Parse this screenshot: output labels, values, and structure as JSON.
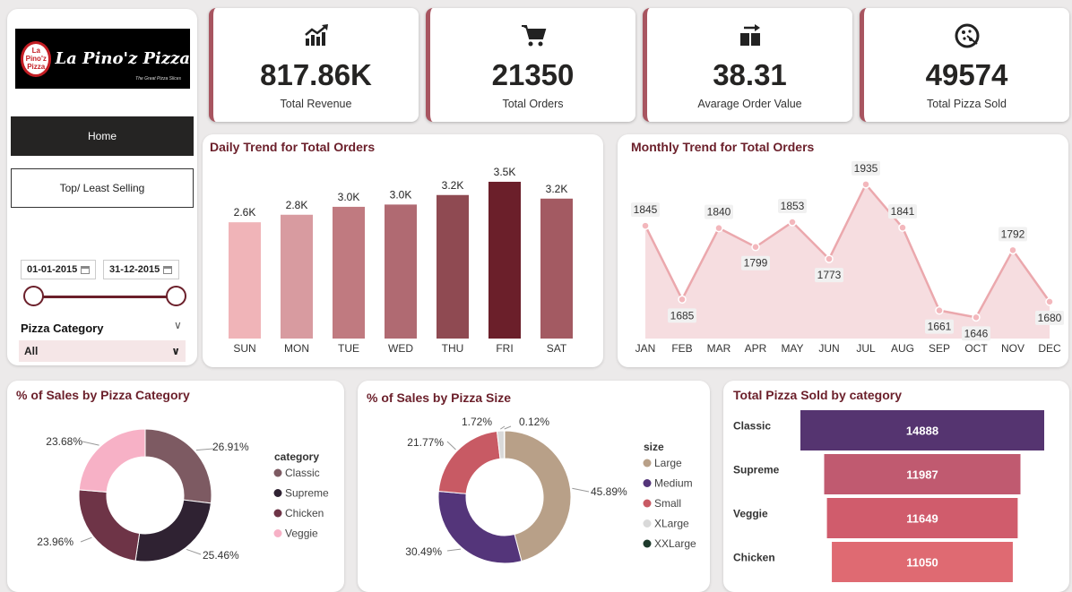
{
  "sidebar": {
    "logo_text": "La Pino'z Pizza",
    "logo_badge_line1": "La Pino'z",
    "logo_badge_line2": "Pizza",
    "logo_tagline": "The Great Pizza Slices",
    "nav": {
      "home": "Home",
      "top_least": "Top/ Least Selling"
    },
    "date_start": "01-01-2015",
    "date_end": "31-12-2015",
    "category_label": "Pizza Category",
    "category_value": "All"
  },
  "kpis": [
    {
      "icon": "trending-up-chart-icon",
      "value": "817.86K",
      "label": "Total Revenue"
    },
    {
      "icon": "shopping-cart-icon",
      "value": "21350",
      "label": "Total Orders"
    },
    {
      "icon": "boxes-arrow-icon",
      "value": "38.31",
      "label": "Avarage Order Value"
    },
    {
      "icon": "pizza-icon",
      "value": "49574",
      "label": "Total Pizza Sold"
    }
  ],
  "colors": {
    "accent": "#6b1f2a",
    "kpi_border": "#a85560",
    "sidebar_active": "#252423"
  },
  "chart_data": [
    {
      "type": "bar",
      "title": "Daily Trend for Total Orders",
      "categories": [
        "SUN",
        "MON",
        "TUE",
        "WED",
        "THU",
        "FRI",
        "SAT"
      ],
      "values": [
        2624,
        2794,
        2973,
        3024,
        3239,
        3538,
        3158
      ],
      "data_labels": [
        "2.6K",
        "2.8K",
        "3.0K",
        "3.0K",
        "3.2K",
        "3.5K",
        "3.2K"
      ],
      "colors": [
        "#f0b4b8",
        "#d89ba0",
        "#c07a80",
        "#b06a72",
        "#8f4a52",
        "#6b1f2a",
        "#a35a62"
      ],
      "ylim": [
        0,
        3800
      ]
    },
    {
      "type": "area",
      "title": "Monthly Trend for Total Orders",
      "categories": [
        "JAN",
        "FEB",
        "MAR",
        "APR",
        "MAY",
        "JUN",
        "JUL",
        "AUG",
        "SEP",
        "OCT",
        "NOV",
        "DEC"
      ],
      "values": [
        1845,
        1685,
        1840,
        1799,
        1853,
        1773,
        1935,
        1841,
        1661,
        1646,
        1792,
        1680
      ],
      "ylim": [
        1600,
        1960
      ]
    },
    {
      "type": "pie",
      "title": "% of Sales by Pizza Category",
      "legend_title": "category",
      "labels": [
        "Classic",
        "Supreme",
        "Chicken",
        "Veggie"
      ],
      "values": [
        26.91,
        25.46,
        23.96,
        23.68
      ],
      "value_labels": [
        "26.91%",
        "25.46%",
        "23.96%",
        "23.68%"
      ],
      "colors": [
        "#7d5a62",
        "#2f2232",
        "#6e3447",
        "#f7b1c6"
      ]
    },
    {
      "type": "pie",
      "title": "% of Sales by Pizza Size",
      "legend_title": "size",
      "labels": [
        "Large",
        "Medium",
        "Small",
        "XLarge",
        "XXLarge"
      ],
      "values": [
        45.89,
        30.49,
        21.77,
        1.72,
        0.12
      ],
      "value_labels": [
        "45.89%",
        "30.49%",
        "21.77%",
        "1.72%",
        "0.12%"
      ],
      "colors": [
        "#b8a088",
        "#54357a",
        "#c85a64",
        "#d9d9d9",
        "#1e3a2c"
      ]
    },
    {
      "type": "bar",
      "title": "Total Pizza Sold by category",
      "categories": [
        "Classic",
        "Supreme",
        "Veggie",
        "Chicken"
      ],
      "values": [
        14888,
        11987,
        11649,
        11050
      ],
      "colors": [
        "#553470",
        "#c05a70",
        "#d05c6c",
        "#df6a72"
      ]
    }
  ]
}
